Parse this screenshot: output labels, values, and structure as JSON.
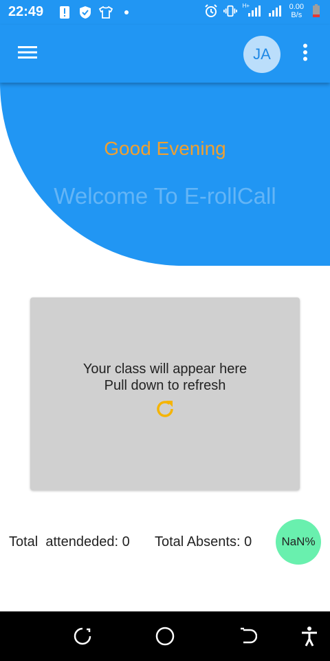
{
  "status_bar": {
    "time": "22:49",
    "net_speed_value": "0.00",
    "net_speed_unit": "B/s",
    "network_type": "H+",
    "icons": [
      "alert-icon",
      "shield-icon",
      "shirt-icon",
      "dot-icon",
      "alarm-icon",
      "vibrate-icon",
      "signal-icon",
      "signal-icon",
      "battery-icon"
    ]
  },
  "app_bar": {
    "avatar_initials": "JA",
    "menu_icon": "hamburger-menu-icon",
    "more_icon": "more-vert-icon"
  },
  "hero": {
    "greeting": "Good Evening",
    "welcome": "Welcome To E-rollCall"
  },
  "class_card": {
    "line1": "Your class will appear here",
    "line2": "Pull down to refresh",
    "refresh_icon": "refresh-icon"
  },
  "stats": {
    "attended_label": "Total  attendeded: 0",
    "absents_label": "Total Absents: 0",
    "percentage": "NaN%"
  },
  "nav_bar": {
    "icons": [
      "recents-icon",
      "home-icon",
      "back-icon",
      "accessibility-icon"
    ]
  },
  "colors": {
    "primary": "#2196f3",
    "greeting": "#f0a030",
    "welcome": "#64b5f6",
    "avatar_bg": "#bbdefb",
    "card_bg": "#d0d0d0",
    "percent_bg": "#69f0ae",
    "refresh_icon": "#f5b400"
  }
}
